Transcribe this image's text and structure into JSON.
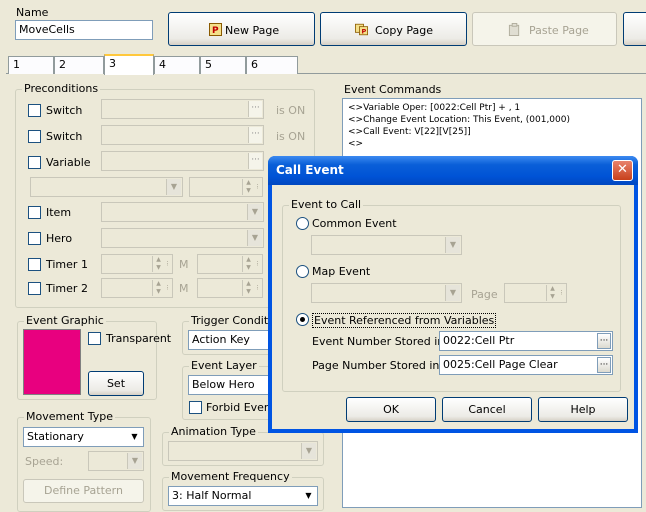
{
  "name": {
    "label": "Name",
    "value": "MoveCells"
  },
  "toolbar": {
    "new_page": "New Page",
    "copy_page": "Copy Page",
    "paste_page": "Paste Page"
  },
  "tabs": [
    "1",
    "2",
    "3",
    "4",
    "5",
    "6"
  ],
  "active_tab": "3",
  "preconditions": {
    "title": "Preconditions",
    "switch1": "Switch",
    "switch2": "Switch",
    "is_on1": "is ON",
    "is_on2": "is ON",
    "variable": "Variable",
    "item": "Item",
    "hero": "Hero",
    "timer1": "Timer 1",
    "timer2": "Timer 2",
    "m1": "M",
    "m2": "M"
  },
  "event_graphic": {
    "title": "Event Graphic",
    "transparent": "Transparent",
    "set": "Set"
  },
  "trigger": {
    "title": "Trigger Conditio",
    "value": "Action Key"
  },
  "event_layer": {
    "title": "Event Layer",
    "value": "Below Hero",
    "forbid": "Forbid Event"
  },
  "movement_type": {
    "title": "Movement Type",
    "value": "Stationary",
    "speed": "Speed:",
    "define": "Define Pattern"
  },
  "animation_type": {
    "title": "Animation Type"
  },
  "movement_frequency": {
    "title": "Movement Frequency",
    "value": "3: Half Normal"
  },
  "event_commands": {
    "title": "Event Commands",
    "lines": [
      "<>Variable Oper: [0022:Cell Ptr] + , 1",
      "<>Change Event Location: This Event, (001,000)",
      "<>Call Event: V[22][V[25]]",
      "<>"
    ]
  },
  "dialog": {
    "title": "Call Event",
    "group": "Event to Call",
    "common_event": "Common Event",
    "map_event": "Map Event",
    "page": "Page",
    "event_ref": "Event Referenced from Variables",
    "event_num_label": "Event Number Stored in",
    "event_num_value": "0022:Cell Ptr",
    "page_num_label": "Page Number Stored in",
    "page_num_value": "0025:Cell Page Clear",
    "ok": "OK",
    "cancel": "Cancel",
    "help": "Help",
    "selected_option": "event_ref"
  },
  "colors": {
    "event_graphic_swatch": "#e8007f",
    "titlebar": "#0054e3",
    "window_bg": "#ece9d8"
  }
}
